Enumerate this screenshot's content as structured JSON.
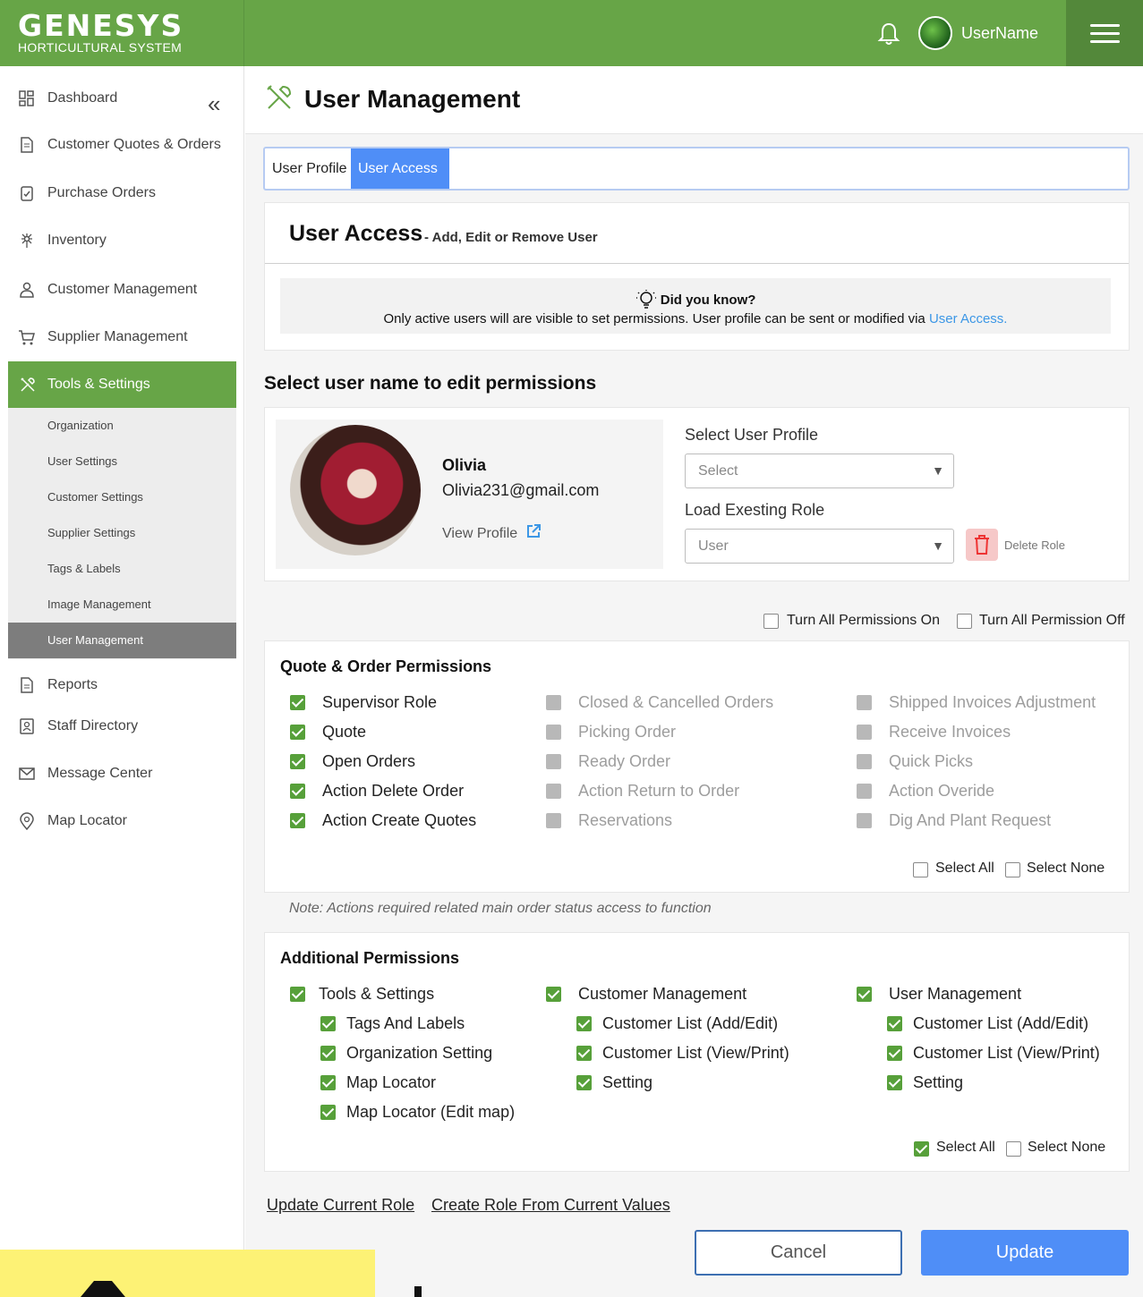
{
  "header": {
    "logo_main": "GENESYS",
    "logo_sub": "HORTICULTURAL SYSTEM",
    "username": "UserName",
    "brand_color": "#67a547"
  },
  "sidebar": {
    "items": [
      {
        "label": "Dashboard",
        "icon": "dashboard-icon"
      },
      {
        "label": "Customer Quotes & Orders",
        "icon": "document-icon"
      },
      {
        "label": "Purchase Orders",
        "icon": "clipboard-icon"
      },
      {
        "label": "Inventory",
        "icon": "plant-icon"
      },
      {
        "label": "Customer Management",
        "icon": "person-icon"
      },
      {
        "label": "Supplier Management",
        "icon": "cart-icon"
      },
      {
        "label": "Tools & Settings",
        "icon": "tools-icon"
      },
      {
        "label": "Reports",
        "icon": "report-icon"
      },
      {
        "label": "Staff Directory",
        "icon": "badge-icon"
      },
      {
        "label": "Message Center",
        "icon": "mail-icon"
      },
      {
        "label": "Map Locator",
        "icon": "pin-icon"
      }
    ],
    "sub_items": [
      "Organization",
      "User Settings",
      "Customer Settings",
      "Supplier Settings",
      "Tags & Labels",
      "Image Management",
      "User Management"
    ]
  },
  "page": {
    "title": "User Management",
    "tabs": [
      "User Profile",
      "User Access"
    ]
  },
  "user_access": {
    "title": "User Access",
    "subtitle": "- Add, Edit or Remove User",
    "tip_title": "Did you know?",
    "tip_body": "Only active users will are visible to set permissions. User profile can be sent or modified via ",
    "tip_link": "User Access."
  },
  "select_heading": "Select user name to edit permissions",
  "user": {
    "name": "Olivia",
    "email": "Olivia231@gmail.com",
    "view_profile": "View Profile",
    "select_profile_label": "Select User Profile",
    "select_profile_value": "Select",
    "load_role_label": "Load Exesting Role",
    "load_role_value": "User",
    "delete_role": "Delete Role"
  },
  "global_toggles": {
    "all_on": "Turn All Permissions On",
    "all_off": "Turn All Permission Off"
  },
  "quote_permissions": {
    "title": "Quote & Order Permissions",
    "col1": [
      "Supervisor Role",
      "Quote",
      "Open Orders",
      "Action Delete Order",
      "Action Create Quotes"
    ],
    "col2": [
      "Closed & Cancelled Orders",
      "Picking Order",
      "Ready Order",
      "Action Return to Order",
      "Reservations"
    ],
    "col3": [
      "Shipped Invoices Adjustment",
      "Receive Invoices",
      "Quick Picks",
      "Action Overide",
      "Dig And Plant Request"
    ],
    "select_all": "Select All",
    "select_none": "Select None",
    "note": "Note: Actions required related main order status access to function"
  },
  "additional_permissions": {
    "title": "Additional Permissions",
    "groups": [
      {
        "label": "Tools & Settings",
        "items": [
          "Tags And Labels",
          "Organization Setting",
          "Map Locator",
          "Map Locator (Edit map)"
        ]
      },
      {
        "label": "Customer Management",
        "items": [
          "Customer List (Add/Edit)",
          "Customer List (View/Print)",
          "Setting"
        ]
      },
      {
        "label": "User Management",
        "items": [
          "Customer List (Add/Edit)",
          "Customer List (View/Print)",
          "Setting"
        ]
      }
    ],
    "select_all": "Select All",
    "select_none": "Select None"
  },
  "footer": {
    "update_role": "Update Current Role",
    "create_role": "Create Role From Current Values",
    "cancel": "Cancel",
    "update": "Update"
  }
}
